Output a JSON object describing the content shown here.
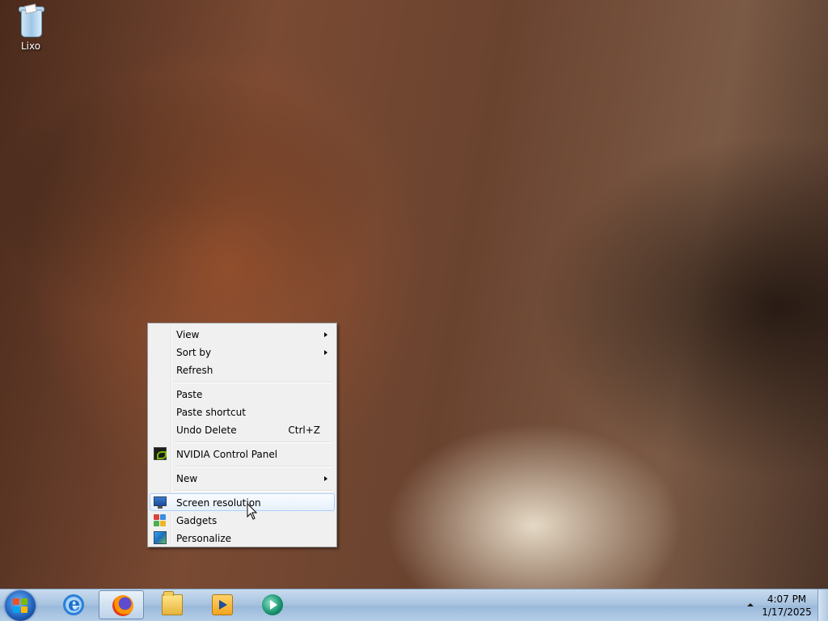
{
  "desktop": {
    "icons": [
      {
        "label": "Lixo",
        "icon": "recycle-bin-icon"
      }
    ]
  },
  "context_menu": {
    "items": [
      {
        "label": "View",
        "has_submenu": true
      },
      {
        "label": "Sort by",
        "has_submenu": true
      },
      {
        "label": "Refresh"
      },
      {
        "label": "Paste"
      },
      {
        "label": "Paste shortcut"
      },
      {
        "label": "Undo Delete",
        "shortcut": "Ctrl+Z"
      },
      {
        "label": "NVIDIA Control Panel",
        "icon": "nvidia-icon"
      },
      {
        "label": "New",
        "has_submenu": true
      },
      {
        "label": "Screen resolution",
        "icon": "monitor-icon",
        "highlighted": true
      },
      {
        "label": "Gadgets",
        "icon": "gadgets-icon"
      },
      {
        "label": "Personalize",
        "icon": "personalize-icon"
      }
    ]
  },
  "taskbar": {
    "start_icon": "windows-logo-icon",
    "pinned": [
      {
        "name": "internet-explorer-icon"
      },
      {
        "name": "firefox-icon",
        "active": true
      },
      {
        "name": "windows-explorer-icon"
      },
      {
        "name": "media-center-icon"
      },
      {
        "name": "windows-media-player-icon"
      }
    ],
    "tray": {
      "time": "4:07 PM",
      "date": "1/17/2025"
    }
  }
}
